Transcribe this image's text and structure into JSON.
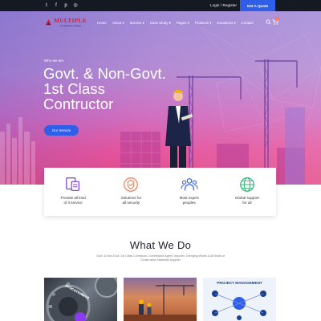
{
  "topbar": {
    "social_icons": [
      "twitter-icon",
      "facebook-icon",
      "pinterest-icon",
      "instagram-icon"
    ],
    "social_glyphs": [
      "t",
      "f",
      "p",
      "◎"
    ],
    "login_label": "Login / Register",
    "quote_label": "Get A Quote"
  },
  "logo": {
    "title": "MULTIPLE",
    "subtitle": "Consortium Limited"
  },
  "nav": {
    "items": [
      {
        "label": "Home"
      },
      {
        "label": "About ▾"
      },
      {
        "label": "Service ▾"
      },
      {
        "label": "Case Study ▾"
      },
      {
        "label": "Pages ▾"
      },
      {
        "label": "Products ▾"
      },
      {
        "label": "Donations ▾"
      },
      {
        "label": "Contact"
      }
    ],
    "cart_count": "0"
  },
  "hero": {
    "kicker": "Who we are",
    "headline": [
      "Govt. & Non-Govt.",
      "1st Class",
      "Contructor"
    ],
    "button_label": "Our Service"
  },
  "features": [
    {
      "icon": "devices-icon",
      "text": "Provide all kind\nof it service"
    },
    {
      "icon": "security-icon",
      "text": "Solutions for\nall security"
    },
    {
      "icon": "team-icon",
      "text": "Most expert\npeoples"
    },
    {
      "icon": "globe-icon",
      "text": "Global support\nfor all"
    }
  ],
  "what_we_do": {
    "title": "What We Do",
    "description": "Govt. & Non-Govt. 1st Class Contractor, Commission Agent, Importer, Dredging Works & All Kinds of Construction Materials Supplier"
  },
  "thumbnails": {
    "gear_text": "procurement",
    "pm_title": "PROJECT MANAGEMENT"
  },
  "colors": {
    "accent": "#2f5ee8",
    "topbar": "#151922",
    "logo_red": "#d71f2e",
    "hero_pink": "#e24a86",
    "hero_violet": "#a48dd9"
  }
}
